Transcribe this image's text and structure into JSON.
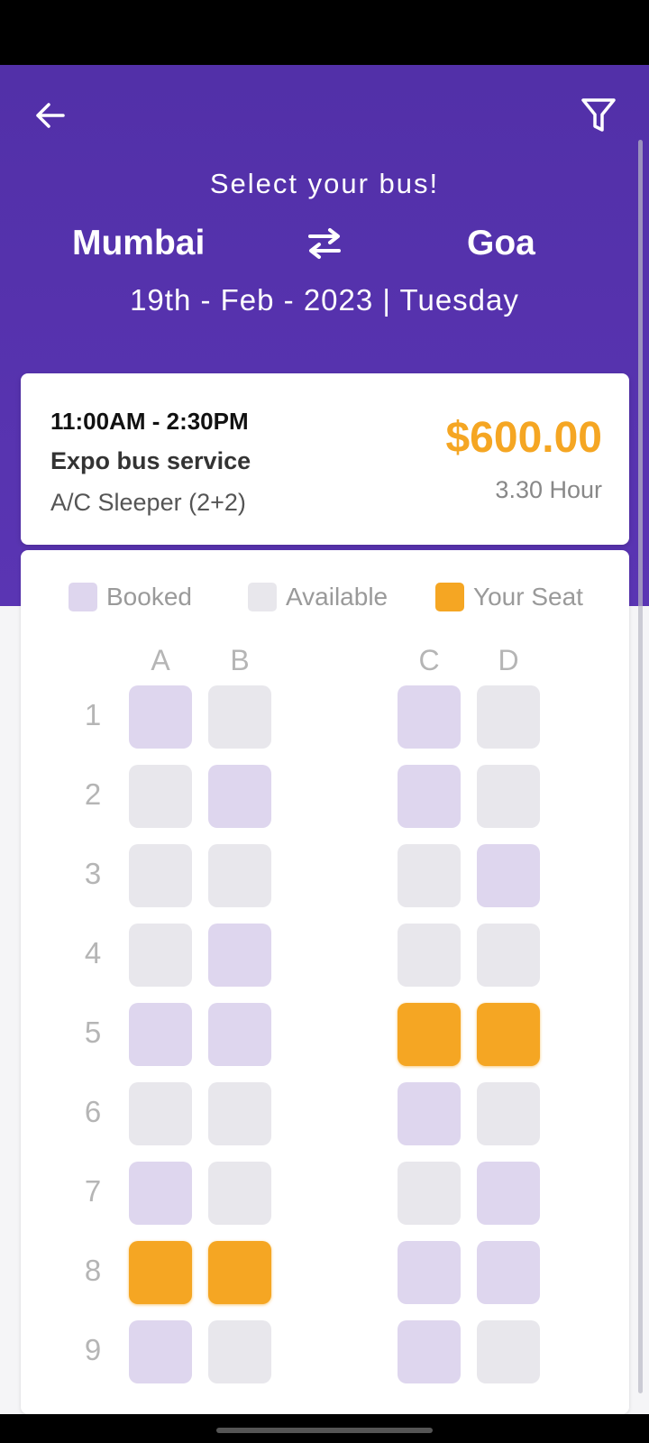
{
  "header": {
    "subtitle": "Select your bus!",
    "from_city": "Mumbai",
    "to_city": "Goa",
    "date": "19th - Feb - 2023 | Tuesday"
  },
  "bus": {
    "time": "11:00AM - 2:30PM",
    "name": "Expo bus service",
    "type": "A/C Sleeper (2+2)",
    "price": "$600.00",
    "duration": "3.30 Hour"
  },
  "legend": {
    "booked": "Booked",
    "available": "Available",
    "your_seat": "Your Seat"
  },
  "columns": [
    "A",
    "B",
    "C",
    "D"
  ],
  "rows": [
    {
      "label": "1",
      "seats": [
        "booked",
        "available",
        "booked",
        "available"
      ]
    },
    {
      "label": "2",
      "seats": [
        "available",
        "booked",
        "booked",
        "available"
      ]
    },
    {
      "label": "3",
      "seats": [
        "available",
        "available",
        "available",
        "booked"
      ]
    },
    {
      "label": "4",
      "seats": [
        "available",
        "booked",
        "available",
        "available"
      ]
    },
    {
      "label": "5",
      "seats": [
        "booked",
        "booked",
        "yours",
        "yours"
      ]
    },
    {
      "label": "6",
      "seats": [
        "available",
        "available",
        "booked",
        "available"
      ]
    },
    {
      "label": "7",
      "seats": [
        "booked",
        "available",
        "available",
        "booked"
      ]
    },
    {
      "label": "8",
      "seats": [
        "yours",
        "yours",
        "booked",
        "booked"
      ]
    },
    {
      "label": "9",
      "seats": [
        "booked",
        "available",
        "booked",
        "available"
      ]
    }
  ],
  "colors": {
    "header_bg": "#5230a8",
    "accent_orange": "#f5a623",
    "booked_seat": "#ded6ee",
    "available_seat": "#e8e7ec"
  },
  "icons": {
    "back": "arrow-left-icon",
    "filter": "filter-funnel-icon",
    "swap": "swap-arrows-icon"
  }
}
